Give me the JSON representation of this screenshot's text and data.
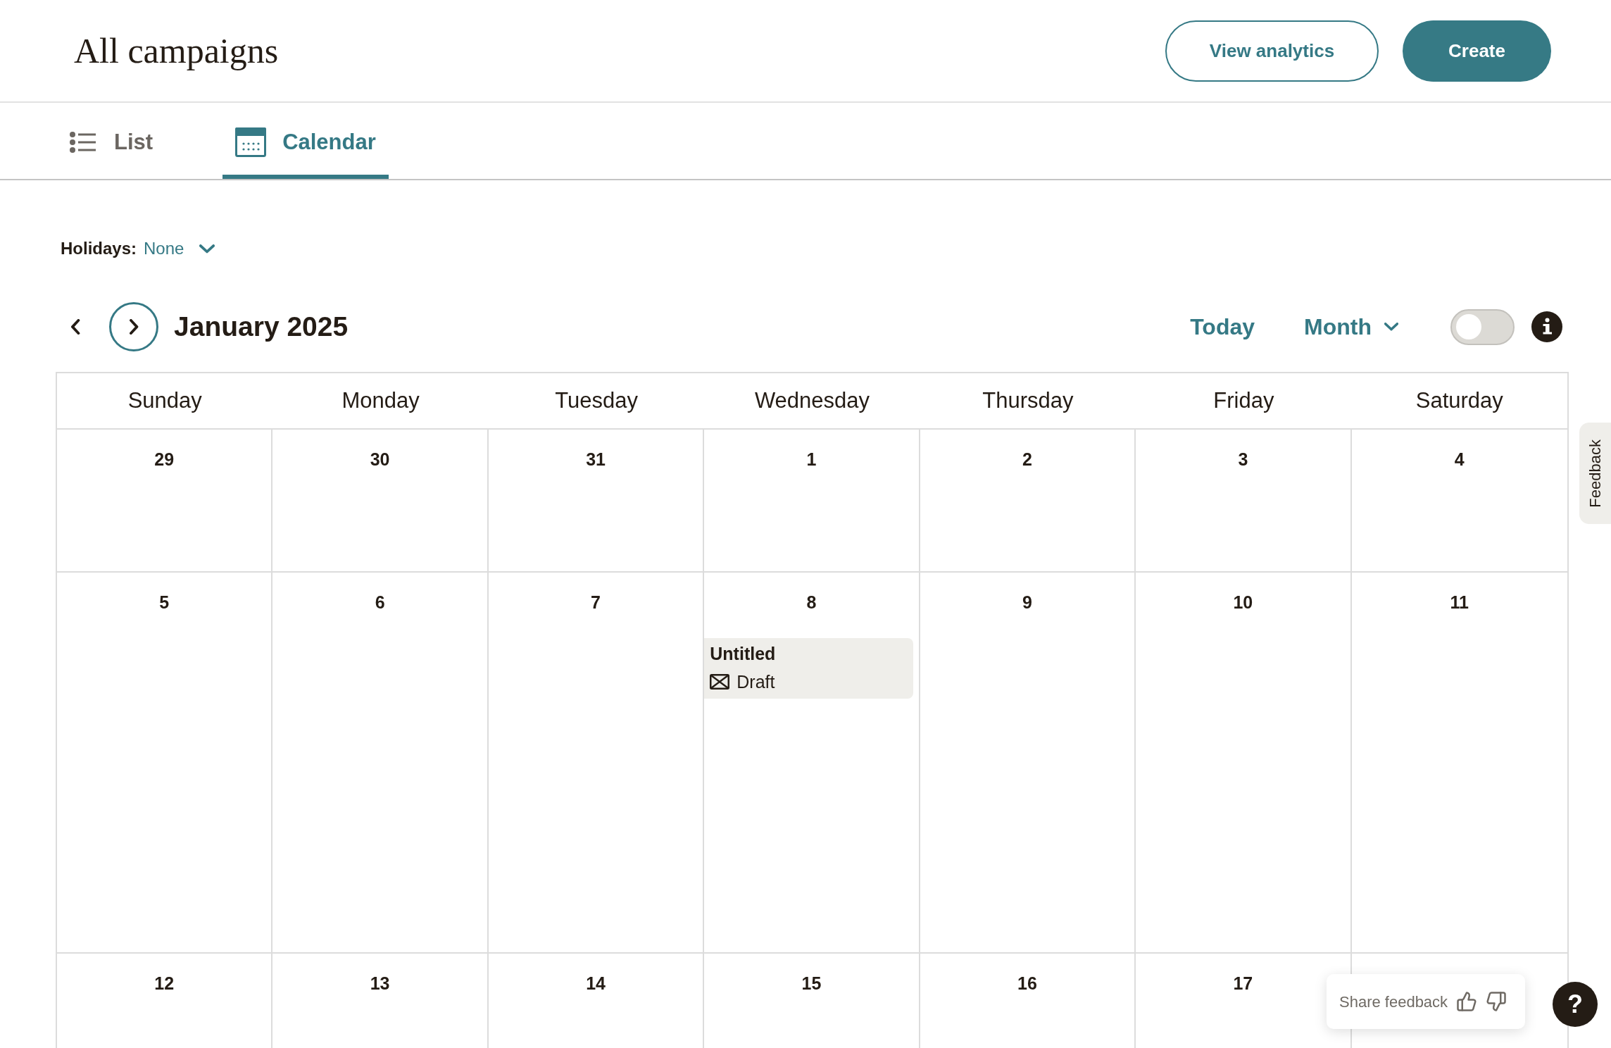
{
  "header": {
    "title": "All campaigns",
    "buttons": [
      {
        "label": "View analytics",
        "kind": "secondary"
      },
      {
        "label": "Create",
        "kind": "primary"
      }
    ]
  },
  "view_tabs": [
    {
      "label": "List",
      "kind": "list",
      "selected": false
    },
    {
      "label": "Calendar",
      "kind": "calendar",
      "selected": true
    }
  ],
  "holidays": {
    "label": "Holidays:",
    "value": "None"
  },
  "month_nav": {
    "title": "January 2025",
    "today": "Today",
    "view": "Month",
    "toggle": {
      "on": false
    }
  },
  "calendar": {
    "weekdays": [
      "Sunday",
      "Monday",
      "Tuesday",
      "Wednesday",
      "Thursday",
      "Friday",
      "Saturday"
    ],
    "weeks": [
      {
        "days": [
          {
            "day": "29"
          },
          {
            "day": "30"
          },
          {
            "day": "31"
          },
          {
            "day": "1"
          },
          {
            "day": "2"
          },
          {
            "day": "3"
          },
          {
            "day": "4"
          }
        ]
      },
      {
        "days": [
          {
            "day": "5"
          },
          {
            "day": "6"
          },
          {
            "day": "7"
          },
          {
            "day": "8",
            "events": [
              {
                "title": "Untitled",
                "status": "Draft"
              }
            ]
          },
          {
            "day": "9"
          },
          {
            "day": "10"
          },
          {
            "day": "11"
          }
        ]
      },
      {
        "days": [
          {
            "day": "12"
          },
          {
            "day": "13"
          },
          {
            "day": "14"
          },
          {
            "day": "15"
          },
          {
            "day": "16"
          },
          {
            "day": "17"
          }
        ]
      }
    ]
  },
  "feedback_tab": {
    "label": "Feedback"
  },
  "share_feedback": {
    "label": "Share feedback"
  },
  "help_button": {
    "label": "?"
  }
}
